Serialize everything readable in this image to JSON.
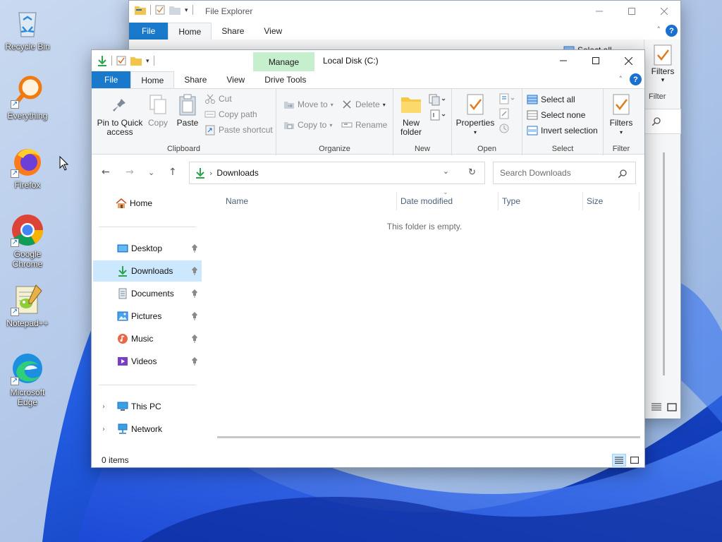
{
  "desktop": {
    "icons": [
      {
        "label": "Recycle Bin"
      },
      {
        "label": "Everything"
      },
      {
        "label": "Firefox"
      },
      {
        "label": "Google Chrome"
      },
      {
        "label": "Notepad++"
      },
      {
        "label": "Microsoft Edge"
      }
    ]
  },
  "background_window": {
    "title": "File Explorer",
    "tabs": {
      "file": "File",
      "home": "Home",
      "share": "Share",
      "view": "View"
    },
    "partial_select_all": "Select all",
    "filters": "Filters",
    "filter_group": "Filter"
  },
  "main_window": {
    "title": "Local Disk (C:)",
    "manage_tab": "Manage",
    "tabs": {
      "file": "File",
      "home": "Home",
      "share": "Share",
      "view": "View",
      "drive_tools": "Drive Tools"
    },
    "help": "?",
    "ribbon": {
      "clipboard": {
        "label": "Clipboard",
        "pin_line1": "Pin to Quick",
        "pin_line2": "access",
        "copy": "Copy",
        "paste": "Paste",
        "cut": "Cut",
        "copy_path": "Copy path",
        "paste_shortcut": "Paste shortcut"
      },
      "organize": {
        "label": "Organize",
        "move_to": "Move to",
        "copy_to": "Copy to",
        "delete": "Delete",
        "rename": "Rename"
      },
      "new": {
        "label": "New",
        "new_folder_line1": "New",
        "new_folder_line2": "folder"
      },
      "open": {
        "label": "Open",
        "properties": "Properties"
      },
      "select": {
        "label": "Select",
        "select_all": "Select all",
        "select_none": "Select none",
        "invert": "Invert selection"
      },
      "filter": {
        "label": "Filter",
        "filters": "Filters"
      }
    },
    "address": {
      "crumb": "Downloads"
    },
    "search": {
      "placeholder": "Search Downloads"
    },
    "nav": {
      "home": "Home",
      "desktop": "Desktop",
      "downloads": "Downloads",
      "documents": "Documents",
      "pictures": "Pictures",
      "music": "Music",
      "videos": "Videos",
      "this_pc": "This PC",
      "network": "Network"
    },
    "columns": {
      "name": "Name",
      "date": "Date modified",
      "type": "Type",
      "size": "Size"
    },
    "empty_message": "This folder is empty.",
    "status": {
      "items": "0 items"
    }
  },
  "colors": {
    "accent": "#1979ca",
    "manage": "#c6efce",
    "selection": "#cce8ff"
  }
}
